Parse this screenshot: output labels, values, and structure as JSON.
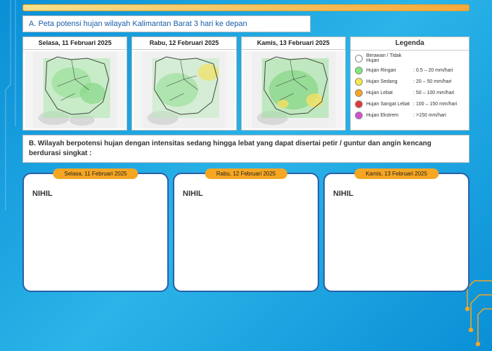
{
  "sectionA": {
    "title": "A. Peta potensi hujan wilayah Kalimantan Barat 3 hari ke depan"
  },
  "maps": [
    {
      "date": "Selasa, 11 Februari 2025"
    },
    {
      "date": "Rabu, 12 Februari 2025"
    },
    {
      "date": "Kamis, 13 Februari 2025"
    }
  ],
  "legend": {
    "title": "Legenda",
    "items": [
      {
        "color": "#ffffff",
        "label": "Berawan / Tidak Hujan",
        "range": ""
      },
      {
        "color": "#7fe87f",
        "label": "Hujan Ringan",
        "range": ": 0.5 – 20 mm/hari"
      },
      {
        "color": "#f7e94a",
        "label": "Hujan Sedang",
        "range": ": 20 – 50 mm/hari"
      },
      {
        "color": "#f5a623",
        "label": "Hujan Lebat",
        "range": ": 50 – 100 mm/hari"
      },
      {
        "color": "#e23838",
        "label": "Hujan Sangat Lebat",
        "range": ": 100 – 150 mm/hari"
      },
      {
        "color": "#d14fd1",
        "label": "Hujan Ekstrem",
        "range": ": >150 mm/hari"
      }
    ]
  },
  "sectionB": {
    "title": "B. Wilayah berpotensi hujan dengan intensitas sedang hingga lebat yang dapat disertai petir / guntur dan angin kencang berdurasi singkat :"
  },
  "forecasts": [
    {
      "date": "Selasa, 11 Februari 2025",
      "body": "NIHIL"
    },
    {
      "date": "Rabu, 12 Februari 2025",
      "body": "NIHIL"
    },
    {
      "date": "Kamis, 13 Februari 2025",
      "body": "NIHIL"
    }
  ],
  "colors": {
    "accent": "#f5a623",
    "cardBorder": "#2a5fa8"
  }
}
